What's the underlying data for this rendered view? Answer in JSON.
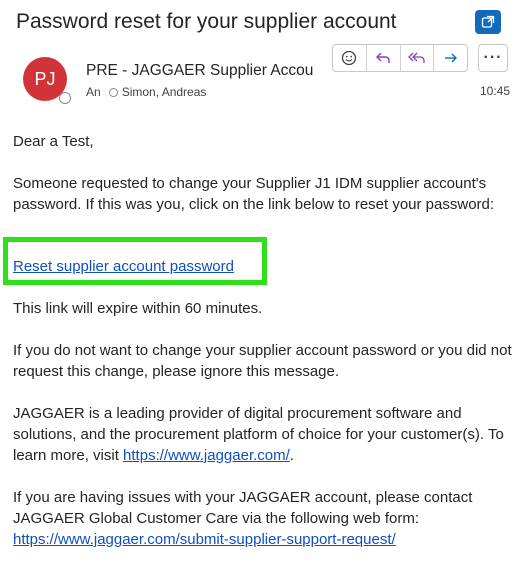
{
  "subject": "Password reset for your supplier account",
  "sender": {
    "initials": "PJ",
    "name": "PRE - JAGGAER Supplier Accour",
    "to_label": "An",
    "recipient": "Simon, Andreas",
    "time": "10:45"
  },
  "colors": {
    "avatar": "#d13438",
    "accent": "#0f6cbd",
    "link": "#0f4fc0",
    "highlight": "#2de01a"
  },
  "icons": {
    "open_window": "open-in-new-window-icon",
    "emoji": "emoji-icon",
    "reply": "reply-icon",
    "reply_all": "reply-all-icon",
    "forward": "forward-icon",
    "more": "more-icon"
  },
  "toolbar": {
    "more_label": "···"
  },
  "body": {
    "greeting": "Dear a Test,",
    "intro": "Someone requested to change your Supplier J1 IDM supplier account's password. If this was you, click on the link below to reset your password:",
    "reset_link": "Reset supplier account password",
    "expiry": "This link will expire within 60 minutes.",
    "ignore": "If you do not want to change your supplier account password or you did not request this change, please ignore this message.",
    "about_prefix": "JAGGAER is a leading provider of digital procurement software and solutions, and the procurement platform of choice for your customer(s). To learn more, visit ",
    "about_link": "https://www.jaggaer.com/",
    "about_suffix": ".",
    "support_text": "If you are having issues with your JAGGAER account, please contact JAGGAER Global Customer Care via the following web form:",
    "support_link": "https://www.jaggaer.com/submit-supplier-support-request/"
  }
}
